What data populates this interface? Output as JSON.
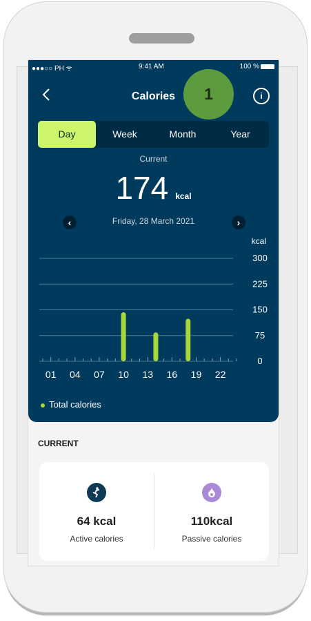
{
  "status": {
    "signal": "●●●○○ PH ᯤ",
    "time": "9:41 AM",
    "battery": "100 %"
  },
  "header": {
    "title": "Calories",
    "marker": "1",
    "info_icon": "info-icon",
    "back_icon": "chevron-left-icon"
  },
  "tabs": [
    {
      "label": "Day"
    },
    {
      "label": "Week"
    },
    {
      "label": "Month"
    },
    {
      "label": "Year"
    }
  ],
  "summary": {
    "label": "Current",
    "value": "174",
    "unit": "kcal",
    "date": "Friday, 28 March 2021"
  },
  "chart_data": {
    "type": "bar",
    "y_unit_label": "kcal",
    "x_ticks": [
      "01",
      "04",
      "07",
      "10",
      "13",
      "16",
      "19",
      "22"
    ],
    "y_ticks": [
      "300",
      "225",
      "150",
      "75",
      "0"
    ],
    "ylim": [
      0,
      300
    ],
    "xlim": [
      0,
      24
    ],
    "bars": [
      {
        "x": 10,
        "value": 143
      },
      {
        "x": 14,
        "value": 84
      },
      {
        "x": 18,
        "value": 124
      }
    ],
    "legend": "Total calories",
    "bar_color": "#a6d63c"
  },
  "section": {
    "title": "CURRENT"
  },
  "cards": [
    {
      "value": "64 kcal",
      "label": "Active calories",
      "icon": "active-person-icon",
      "color": "#0e3a55"
    },
    {
      "value": "110kcal",
      "label": "Passive calories",
      "icon": "flame-icon",
      "color": "#a98ad6"
    }
  ],
  "colors": {
    "primary": "#003a5c",
    "accent": "#ccf56c",
    "marker": "#5d9c3d"
  }
}
